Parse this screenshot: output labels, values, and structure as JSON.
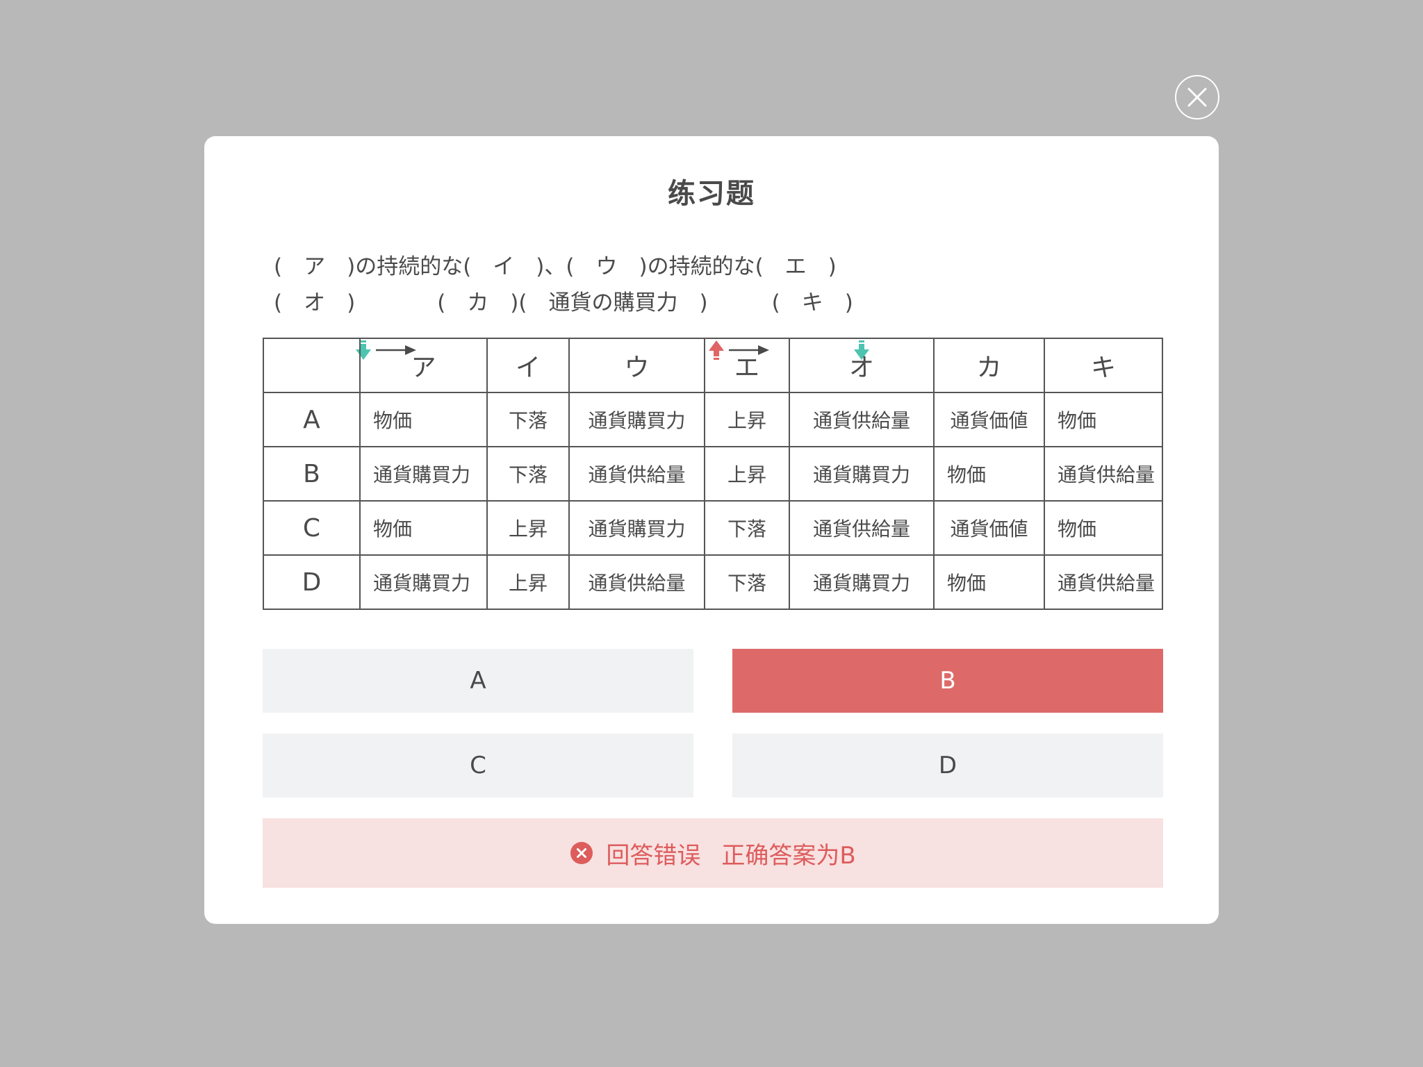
{
  "modal": {
    "title": "练习题"
  },
  "question": {
    "line1": "(　ア　)の持続的な(　イ　)、(　ウ　)の持続的な(　エ　)",
    "line2_part1": "(　オ　)",
    "line2_part2": "(　カ　)(　通貨の購買力　)",
    "line2_part3": "(　キ　)"
  },
  "icons": {
    "close": "close-circle-icon",
    "down_arrow": "down-arrow-icon",
    "up_arrow": "up-arrow-icon",
    "right_arrow": "right-arrow-icon",
    "error": "error-x-icon",
    "down_color": "#4cc4b0",
    "up_color": "#e06464"
  },
  "table": {
    "headers": [
      "",
      "ア",
      "イ",
      "ウ",
      "エ",
      "オ",
      "カ",
      "キ"
    ],
    "rows": [
      {
        "label": "A",
        "cells": [
          "物価",
          "下落",
          "通貨購買力",
          "上昇",
          "通貨供給量",
          "通貨価値",
          "物価"
        ]
      },
      {
        "label": "B",
        "cells": [
          "通貨購買力",
          "下落",
          "通貨供給量",
          "上昇",
          "通貨購買力",
          "物価",
          "通貨供給量"
        ]
      },
      {
        "label": "C",
        "cells": [
          "物価",
          "上昇",
          "通貨購買力",
          "下落",
          "通貨供給量",
          "通貨価値",
          "物価"
        ]
      },
      {
        "label": "D",
        "cells": [
          "通貨購買力",
          "上昇",
          "通貨供給量",
          "下落",
          "通貨購買力",
          "物価",
          "通貨供給量"
        ]
      }
    ]
  },
  "options": [
    {
      "label": "A",
      "selected": false
    },
    {
      "label": "B",
      "selected": true
    },
    {
      "label": "C",
      "selected": false
    },
    {
      "label": "D",
      "selected": false
    }
  ],
  "feedback": {
    "status": "回答错误",
    "answer": "正确答案为B",
    "color": "#dd5c5c",
    "background": "#f8e1e1"
  },
  "colors": {
    "backdrop": "#b8b8b8",
    "selected": "#dd6a68",
    "option_bg": "#f1f2f4"
  }
}
